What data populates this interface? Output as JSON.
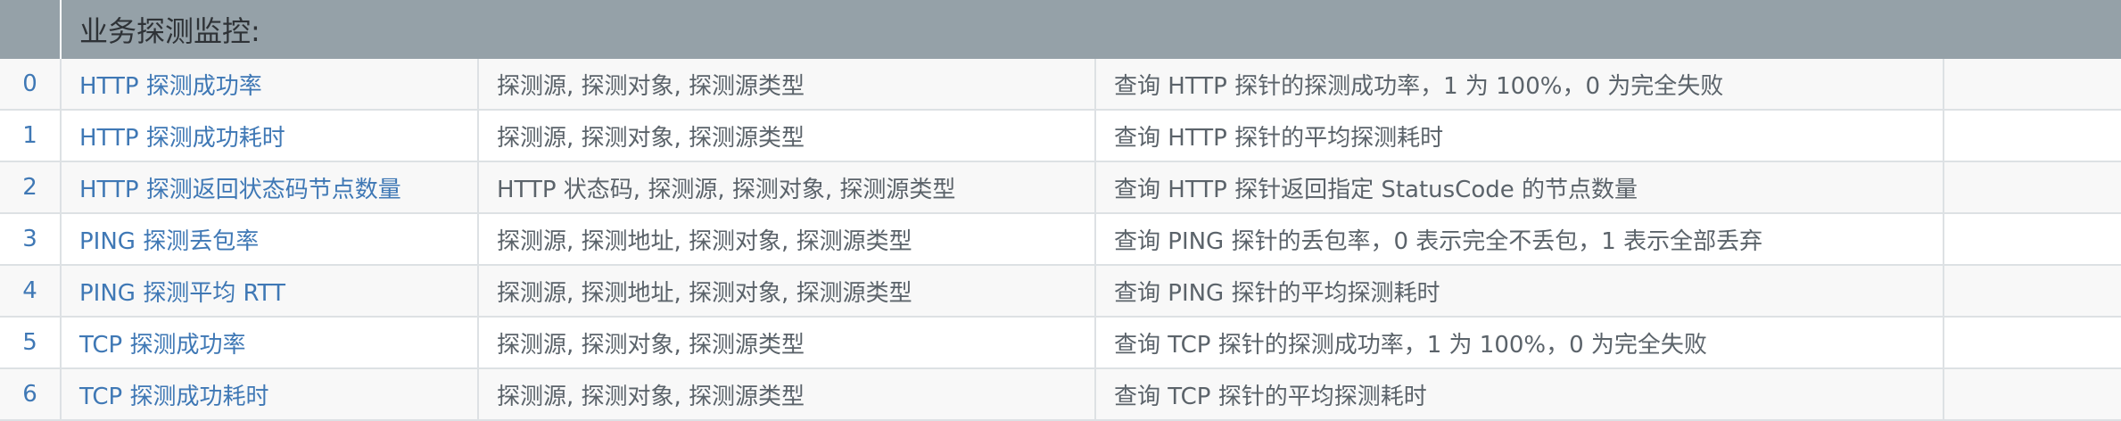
{
  "header": {
    "title": "业务探测监控:"
  },
  "rows": [
    {
      "index": "0",
      "name": "HTTP 探测成功率",
      "labels": "探测源, 探测对象, 探测源类型",
      "description": "查询 HTTP 探针的探测成功率，1 为 100%，0 为完全失败"
    },
    {
      "index": "1",
      "name": "HTTP 探测成功耗时",
      "labels": "探测源, 探测对象, 探测源类型",
      "description": "查询 HTTP 探针的平均探测耗时"
    },
    {
      "index": "2",
      "name": "HTTP 探测返回状态码节点数量",
      "labels": "HTTP 状态码, 探测源, 探测对象, 探测源类型",
      "description": "查询 HTTP 探针返回指定 StatusCode 的节点数量"
    },
    {
      "index": "3",
      "name": "PING 探测丢包率",
      "labels": "探测源, 探测地址, 探测对象, 探测源类型",
      "description": "查询 PING 探针的丢包率，0 表示完全不丢包，1 表示全部丢弃"
    },
    {
      "index": "4",
      "name": "PING 探测平均 RTT",
      "labels": "探测源, 探测地址, 探测对象, 探测源类型",
      "description": "查询 PING 探针的平均探测耗时"
    },
    {
      "index": "5",
      "name": "TCP 探测成功率",
      "labels": "探测源, 探测对象, 探测源类型",
      "description": "查询 TCP 探针的探测成功率，1 为 100%，0 为完全失败"
    },
    {
      "index": "6",
      "name": "TCP 探测成功耗时",
      "labels": "探测源, 探测对象, 探测源类型",
      "description": "查询 TCP 探针的平均探测耗时"
    }
  ]
}
